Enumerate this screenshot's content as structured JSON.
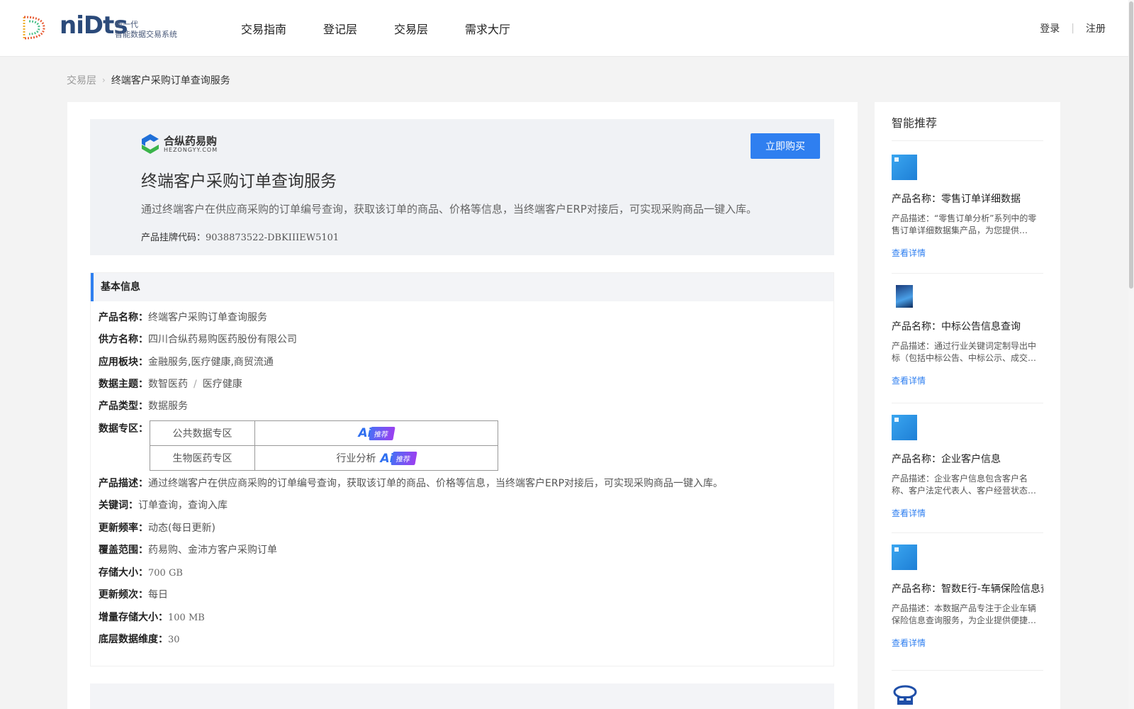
{
  "header": {
    "logo_word": "niDts",
    "logo_sub_line1": "新一代",
    "logo_sub_line2": "智能数据交易系统",
    "nav": [
      "交易指南",
      "登记层",
      "交易层",
      "需求大厅"
    ],
    "login": "登录",
    "register": "注册"
  },
  "breadcrumb": {
    "parent": "交易层",
    "current": "终端客户采购订单查询服务"
  },
  "hero": {
    "brand_name": "合纵药易购",
    "brand_en": "HEZONGYY.COM",
    "title": "终端客户采购订单查询服务",
    "description": "通过终端客户在供应商采购的订单编号查询，获取该订单的商品、价格等信息，当终端客户ERP对接后，可实现采购商品一键入库。",
    "code_label": "产品挂牌代码：",
    "code_value": "9038873522-DBKIIIEW5101",
    "buy_label": "立即购买"
  },
  "basic": {
    "heading": "基本信息",
    "product_name": {
      "label": "产品名称：",
      "value": "终端客户采购订单查询服务"
    },
    "supplier": {
      "label": "供方名称：",
      "value": "四川合纵药易购医药股份有限公司"
    },
    "sector": {
      "label": "应用板块：",
      "value": "金融服务,医疗健康,商贸流通"
    },
    "theme": {
      "label": "数据主题：",
      "value1": "数智医药",
      "sep": "/",
      "value2": "医疗健康"
    },
    "type": {
      "label": "产品类型：",
      "value": "数据服务"
    },
    "zone": {
      "label": "数据专区：",
      "rows": [
        {
          "name": "公共数据专区",
          "tag_text": ""
        },
        {
          "name": "生物医药专区",
          "tag_text": "行业分析"
        }
      ],
      "ai_text": "Ai",
      "rec_text": "推荐"
    },
    "desc": {
      "label": "产品描述：",
      "value": "通过终端客户在供应商采购的订单编号查询，获取该订单的商品、价格等信息，当终端客户ERP对接后，可实现采购商品一键入库。"
    },
    "keywords": {
      "label": "关键词：",
      "value": "订单查询，查询入库"
    },
    "freq": {
      "label": "更新频率：",
      "value": "动态(每日更新)"
    },
    "coverage": {
      "label": "覆盖范围：",
      "value": "药易购、金沛方客户采购订单"
    },
    "storage": {
      "label": "存储大小：",
      "value": "700 GB"
    },
    "freq2": {
      "label": "更新频次：",
      "value": "每日"
    },
    "inc_storage": {
      "label": "增量存储大小：",
      "value": "100 MB"
    },
    "dims": {
      "label": "底层数据维度：",
      "value": "30"
    }
  },
  "sidebar": {
    "title": "智能推荐",
    "link_label": "查看详情",
    "items": [
      {
        "name": "产品名称：零售订单详细数据",
        "desc": "产品描述：“零售订单分析”系列中的零售订单详细数据集产品，为您提供…"
      },
      {
        "name": "产品名称：中标公告信息查询",
        "desc": "产品描述：通过行业关键词定制导出中标（包括中标公告、中标公示、成交…"
      },
      {
        "name": "产品名称：企业客户信息",
        "desc": "产品描述：企业客户信息包含客户名称、客户法定代表人、客户经营状态…"
      },
      {
        "name": "产品名称：智数E行-车辆保险信息查询",
        "desc": "产品描述：本数据产品专注于企业车辆保险信息查询服务，为企业提供便捷…"
      }
    ]
  },
  "colors": {
    "accent": "#2f7ff0",
    "text": "#333333",
    "bg": "#f3f3f3"
  }
}
